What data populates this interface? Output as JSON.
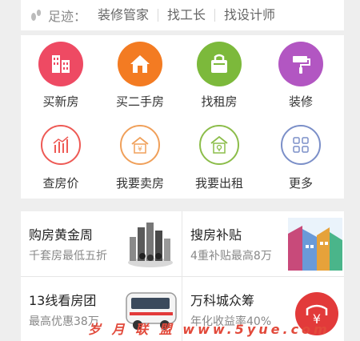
{
  "footprint": {
    "label": "足迹：",
    "links": [
      "装修管家",
      "找工长",
      "找设计师"
    ]
  },
  "services": [
    {
      "label": "买新房",
      "icon": "building-icon",
      "color": "#ee4a63"
    },
    {
      "label": "买二手房",
      "icon": "house-icon",
      "color": "#f37b22"
    },
    {
      "label": "找租房",
      "icon": "bag-icon",
      "color": "#7cb93b"
    },
    {
      "label": "装修",
      "icon": "paint-roller-icon",
      "color": "#b256c2"
    },
    {
      "label": "查房价",
      "icon": "price-chart-icon",
      "color": "#ee5a55"
    },
    {
      "label": "我要卖房",
      "icon": "sell-house-icon",
      "color": "#f0a05a"
    },
    {
      "label": "我要出租",
      "icon": "rent-house-icon",
      "color": "#8cbd4a"
    },
    {
      "label": "更多",
      "icon": "more-grid-icon",
      "color": "#7b8fc8"
    }
  ],
  "promos": [
    {
      "title": "购房黄金周",
      "subtitle": "千套房最低五折"
    },
    {
      "title": "搜房补贴",
      "subtitle": "4重补贴最高8万"
    },
    {
      "title": "13线看房团",
      "subtitle": "最高优惠38万"
    },
    {
      "title": "万科城众筹",
      "subtitle": "年化收益率40%"
    }
  ],
  "watermark": "岁 月 联 盟 www.5yue.com"
}
